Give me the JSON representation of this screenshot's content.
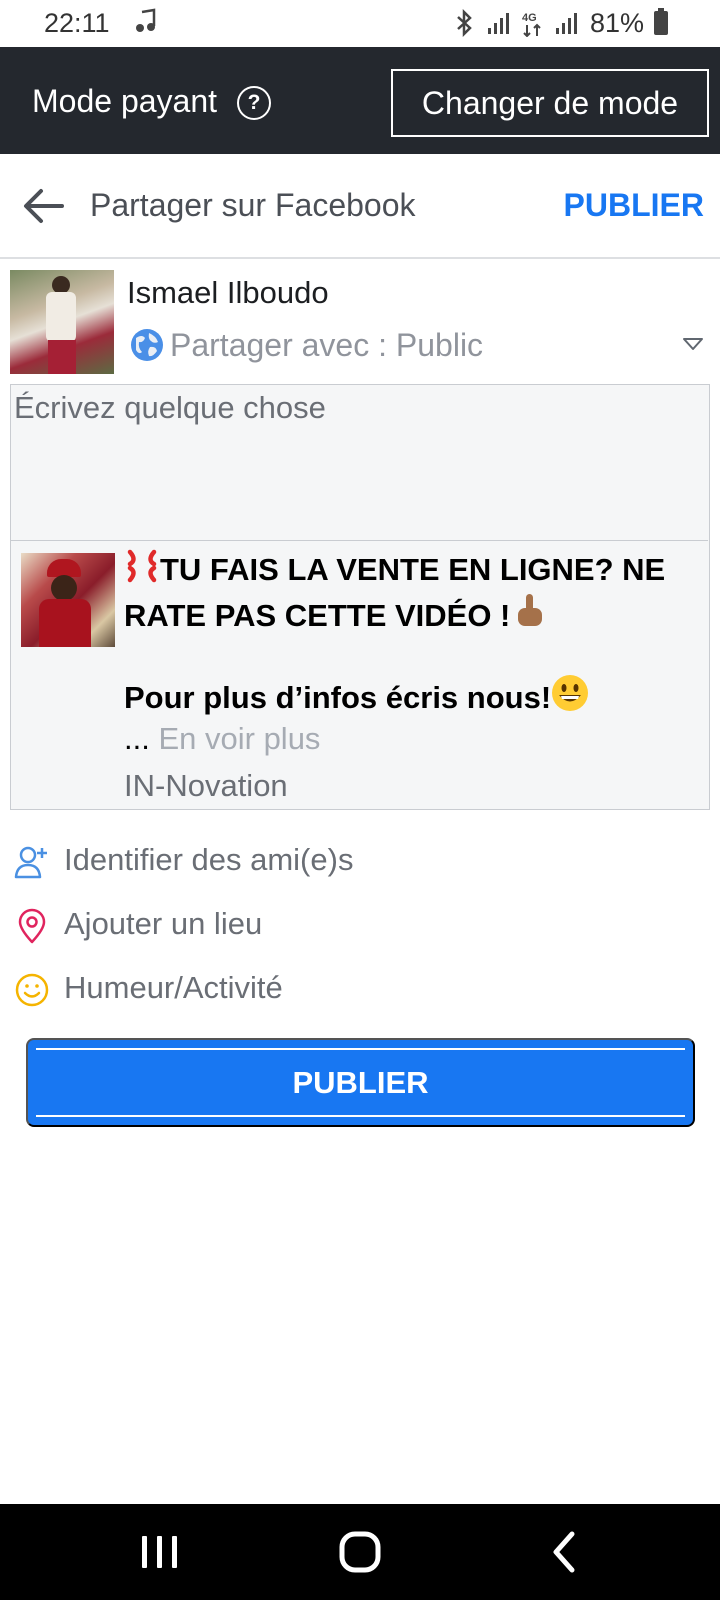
{
  "status_bar": {
    "time": "22:11",
    "battery": "81%"
  },
  "mode_bar": {
    "label": "Mode payant",
    "help": "?",
    "button": "Changer de mode"
  },
  "header": {
    "title": "Partager sur Facebook",
    "publish": "PUBLIER"
  },
  "author": {
    "name": "Ismael Ilboudo",
    "privacy": "Partager avec : Public"
  },
  "composer": {
    "placeholder": "Écrivez quelque chose"
  },
  "attachment": {
    "headline": "TU FAIS LA VENTE EN LIGNE? NE RATE PAS CETTE VIDÉO !",
    "line2": "Pour plus d’infos écris nous!",
    "ellipsis": "...",
    "see_more": "En voir plus",
    "source": "IN-Novation"
  },
  "actions": [
    {
      "label": "Identifier des ami(e)s",
      "icon": "add-friend-icon"
    },
    {
      "label": "Ajouter un lieu",
      "icon": "location-pin-icon"
    },
    {
      "label": "Humeur/Activité",
      "icon": "smiley-icon"
    }
  ],
  "publish_button": "PUBLIER",
  "colors": {
    "brand_blue": "#1877f2",
    "mode_bar_bg": "#24282e"
  }
}
